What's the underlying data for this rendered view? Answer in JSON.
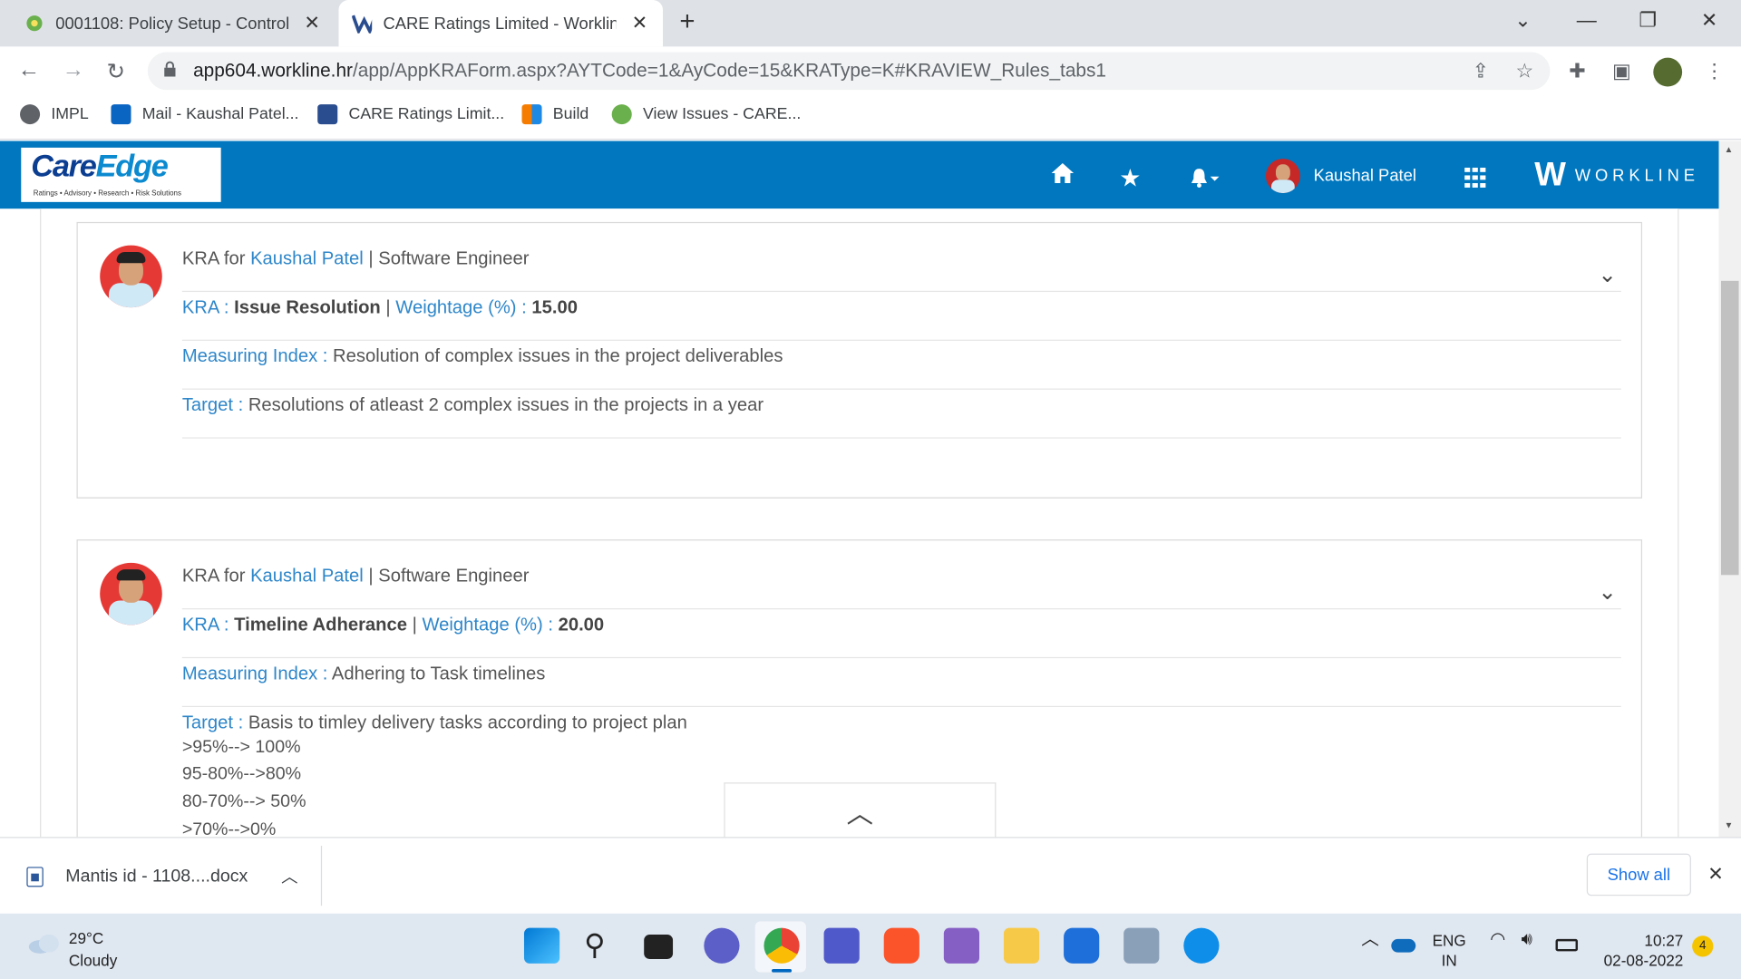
{
  "browser": {
    "tabs": [
      {
        "title": "0001108: Policy Setup - Control",
        "close": "✕"
      },
      {
        "title": "CARE Ratings Limited - Workline",
        "close": "✕"
      }
    ],
    "new_tab": "+",
    "url_host": "app604.workline.hr",
    "url_path": "/app/AppKRAForm.aspx?AYTCode=1&AyCode=15&KRAType=K#KRAVIEW_Rules_tabs1",
    "bookmarks": [
      {
        "label": "IMPL"
      },
      {
        "label": "Mail - Kaushal Patel..."
      },
      {
        "label": "CARE Ratings Limit..."
      },
      {
        "label": "Build"
      },
      {
        "label": "View Issues - CARE..."
      }
    ]
  },
  "app": {
    "logo_main": "Care",
    "logo_accent": "Edge",
    "logo_tagline": "Ratings • Advisory • Research • Risk Solutions",
    "user_name": "Kaushal Patel",
    "brand_mark": "W",
    "brand_name": "WORKLINE"
  },
  "labels": {
    "kra_for": "KRA for ",
    "sep": " | ",
    "kra": "KRA :",
    "weightage": "Weightage (%) :",
    "measuring_index": "Measuring Index :",
    "target": "Target :"
  },
  "kras": [
    {
      "employee": "Kaushal Patel",
      "designation": "Software Engineer",
      "kra_name": "Issue Resolution",
      "weightage": "15.00",
      "measuring_index": "Resolution of complex issues in the project deliverables",
      "target": "Resolutions of atleast 2 complex issues in the projects in a year",
      "target_lines": []
    },
    {
      "employee": "Kaushal Patel",
      "designation": "Software Engineer",
      "kra_name": "Timeline Adherance",
      "weightage": "20.00",
      "measuring_index": "Adhering to Task timelines",
      "target": "Basis to timley delivery tasks according to project plan",
      "target_lines": [
        ">95%--> 100%",
        "95-80%-->80%",
        "80-70%--> 50%",
        ">70%-->0%"
      ]
    }
  ],
  "download": {
    "file": "Mantis id - 1108....docx",
    "show_all": "Show all"
  },
  "taskbar": {
    "temp": "29°C",
    "weather": "Cloudy",
    "lang": "ENG",
    "region": "IN",
    "time": "10:27",
    "date": "02-08-2022",
    "notifications": "4"
  }
}
